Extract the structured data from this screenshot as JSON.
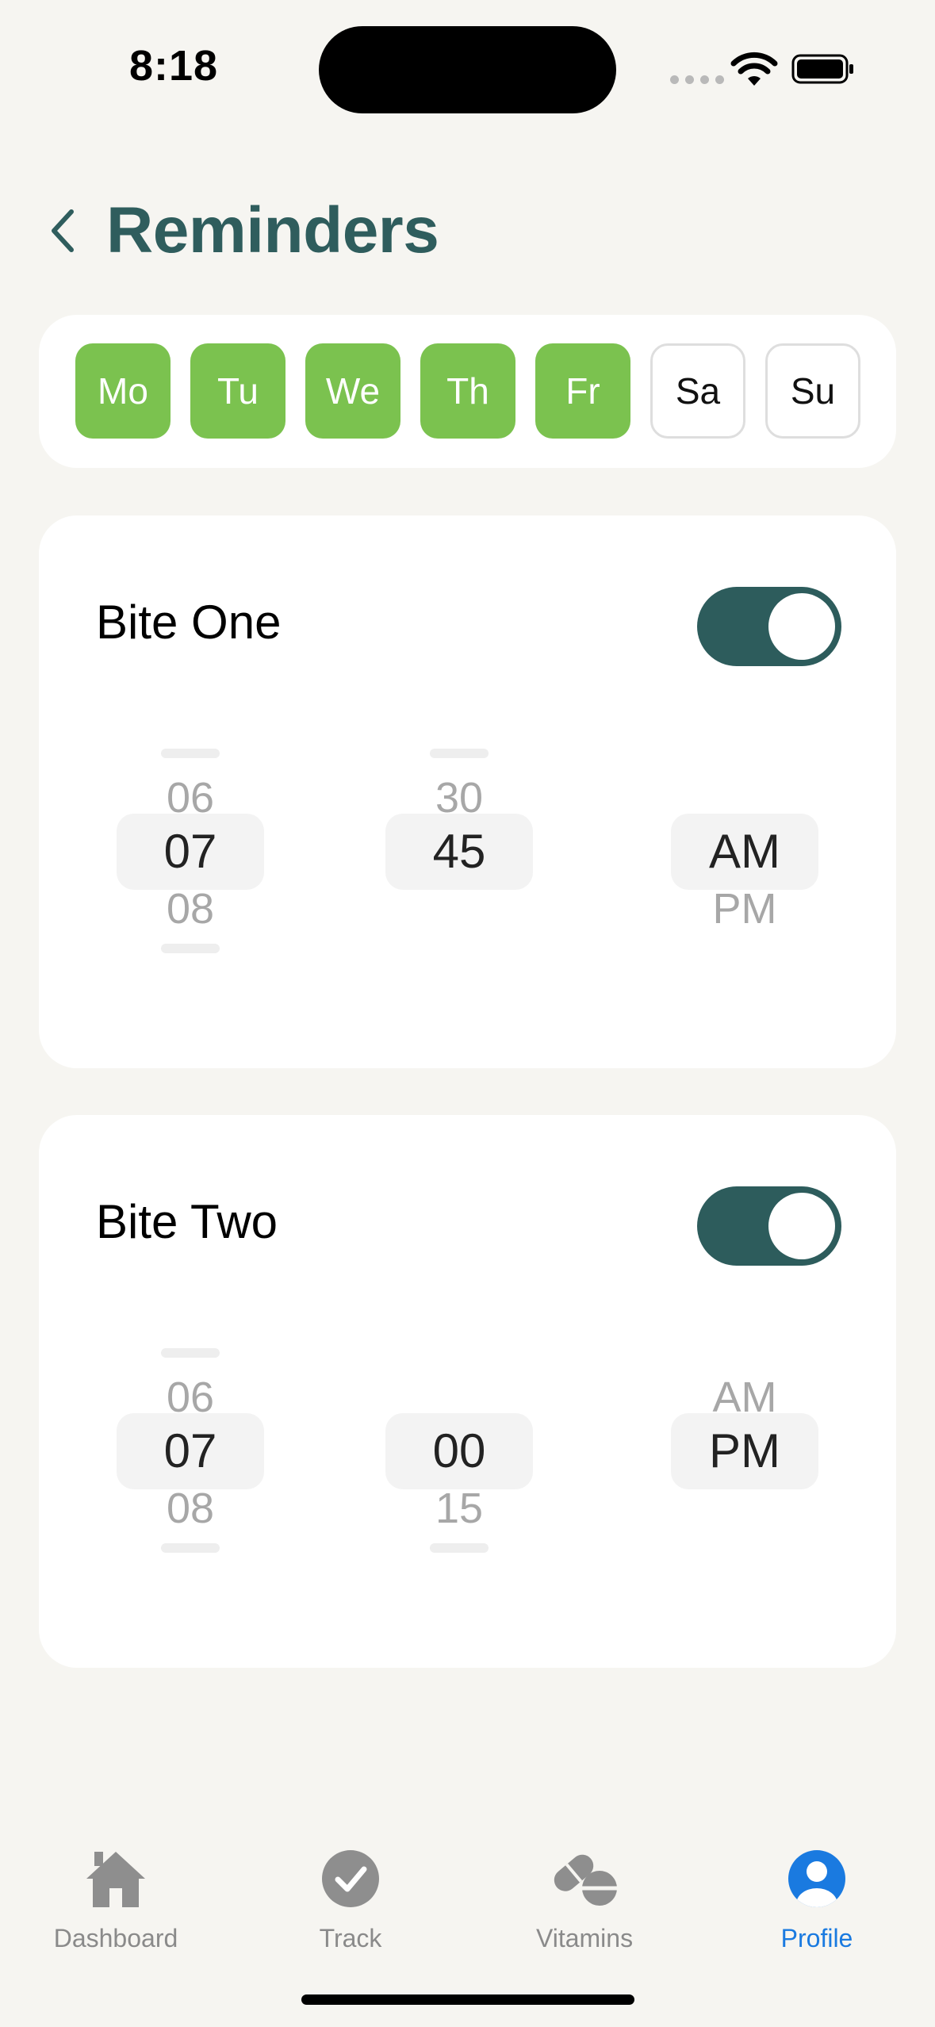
{
  "status_bar": {
    "time": "8:18",
    "icons": [
      "cellular-signal-icon",
      "wifi-icon",
      "battery-icon"
    ]
  },
  "header": {
    "back_icon": "chevron-left-icon",
    "title": "Reminders"
  },
  "days": [
    {
      "label": "Mo",
      "selected": true
    },
    {
      "label": "Tu",
      "selected": true
    },
    {
      "label": "We",
      "selected": true
    },
    {
      "label": "Th",
      "selected": true
    },
    {
      "label": "Fr",
      "selected": true
    },
    {
      "label": "Sa",
      "selected": false
    },
    {
      "label": "Su",
      "selected": false
    }
  ],
  "reminders": [
    {
      "title": "Bite One",
      "enabled": true,
      "hour": {
        "above": "06",
        "current": "07",
        "below": "08"
      },
      "minute": {
        "above": "30",
        "current": "45",
        "below": ""
      },
      "period": {
        "above": "",
        "current": "AM",
        "below": "PM"
      }
    },
    {
      "title": "Bite Two",
      "enabled": true,
      "hour": {
        "above": "06",
        "current": "07",
        "below": "08"
      },
      "minute": {
        "above": "",
        "current": "00",
        "below": "15"
      },
      "period": {
        "above": "AM",
        "current": "PM",
        "below": ""
      }
    }
  ],
  "tab_bar": {
    "tabs": [
      {
        "label": "Dashboard",
        "icon": "house-icon",
        "active": false
      },
      {
        "label": "Track",
        "icon": "checkmark-circle-icon",
        "active": false
      },
      {
        "label": "Vitamins",
        "icon": "pills-icon",
        "active": false
      },
      {
        "label": "Profile",
        "icon": "person-circle-icon",
        "active": true
      }
    ]
  },
  "colors": {
    "background": "#f6f5f1",
    "accent_green": "#7bc24f",
    "title_teal": "#2f5d5d",
    "toggle_on": "#2d5c5c",
    "tab_active": "#1a7ae0",
    "tab_inactive": "#8a8a8a"
  }
}
